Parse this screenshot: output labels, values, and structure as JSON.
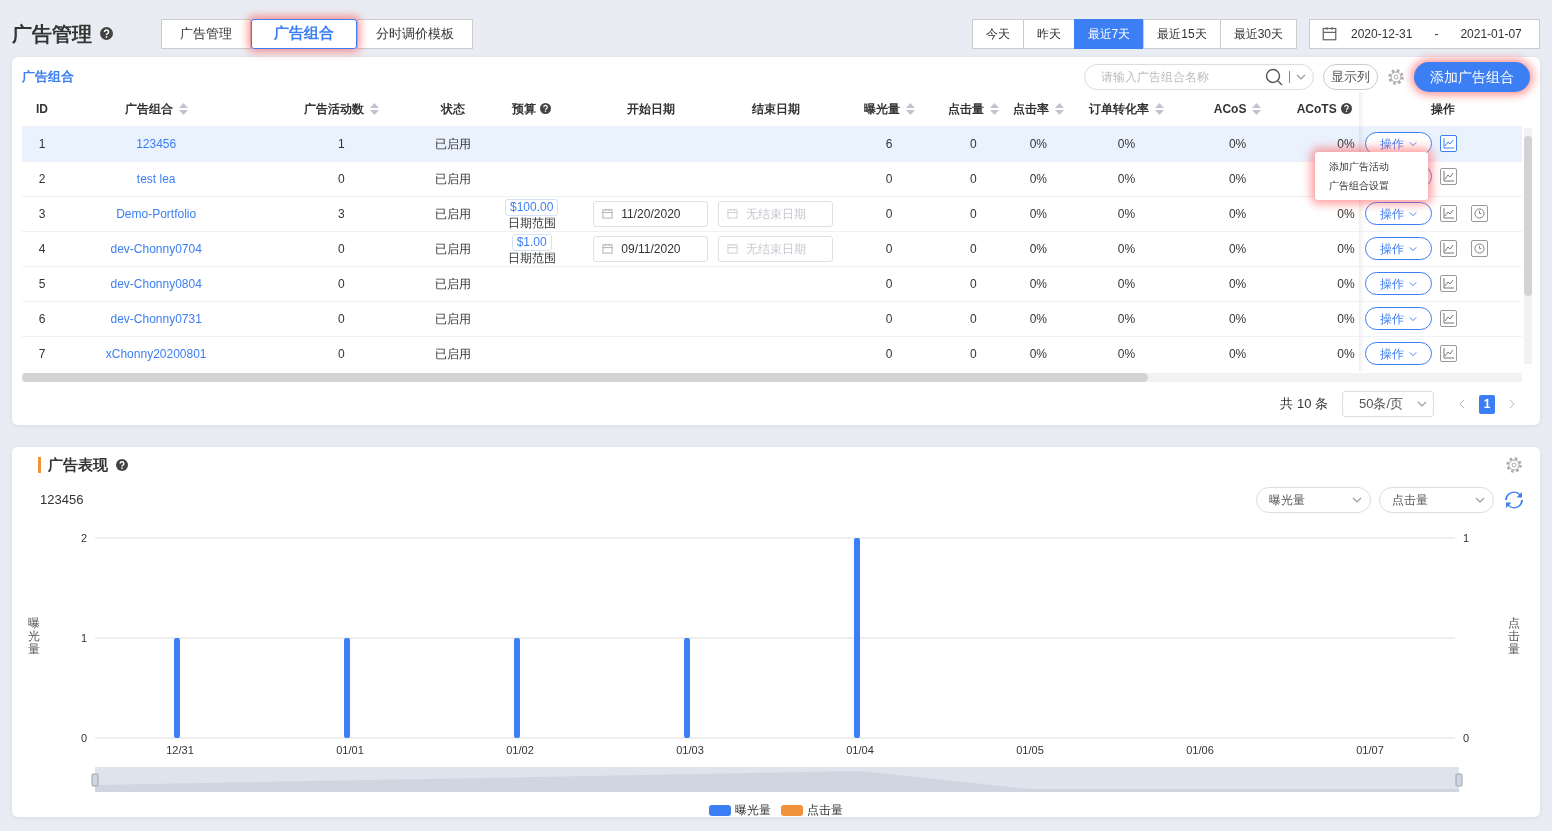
{
  "header": {
    "title": "广告管理",
    "tabs": [
      {
        "label": "广告管理",
        "selected": false
      },
      {
        "label": "广告组合",
        "selected": true
      },
      {
        "label": "分时调价模板",
        "selected": false
      }
    ],
    "ranges": [
      {
        "label": "今天",
        "selected": false
      },
      {
        "label": "昨天",
        "selected": false
      },
      {
        "label": "最近7天",
        "selected": true
      },
      {
        "label": "最近15天",
        "selected": false
      },
      {
        "label": "最近30天",
        "selected": false
      }
    ],
    "date_range": {
      "start": "2020-12-31",
      "separator": "-",
      "end": "2021-01-07"
    }
  },
  "portfolios": {
    "title": "广告组合",
    "search": {
      "placeholder": "请输入广告组合名称"
    },
    "columns_button": "显示列",
    "add_button": "添加广告组合",
    "columns": [
      {
        "label": "ID",
        "sortable": false,
        "help": false
      },
      {
        "label": "广告组合",
        "sortable": true,
        "help": false
      },
      {
        "label": "广告活动数",
        "sortable": true,
        "help": false
      },
      {
        "label": "状态",
        "sortable": false,
        "help": false
      },
      {
        "label": "预算",
        "sortable": false,
        "help": true
      },
      {
        "label": "开始日期",
        "sortable": false,
        "help": false
      },
      {
        "label": "结束日期",
        "sortable": false,
        "help": false
      },
      {
        "label": "曝光量",
        "sortable": true,
        "help": false
      },
      {
        "label": "点击量",
        "sortable": true,
        "help": false
      },
      {
        "label": "点击率",
        "sortable": true,
        "help": false
      },
      {
        "label": "订单转化率",
        "sortable": true,
        "help": false
      },
      {
        "label": "ACoS",
        "sortable": true,
        "help": false
      },
      {
        "label": "ACoTS",
        "sortable": false,
        "help": true
      },
      {
        "label": "操作",
        "sortable": false,
        "help": false
      }
    ],
    "rows": [
      {
        "id": "1",
        "name": "123456",
        "campaigns": "1",
        "status": "已启用",
        "impressions": "6",
        "clicks": "0",
        "ctr": "0%",
        "cvr": "0%",
        "acos": "0%",
        "acots": "0%",
        "action": "操作",
        "schedule": false,
        "selected": true
      },
      {
        "id": "2",
        "name": "test lea",
        "campaigns": "0",
        "status": "已启用",
        "impressions": "0",
        "clicks": "0",
        "ctr": "0%",
        "cvr": "0%",
        "acos": "0%",
        "schedule": false,
        "selected": false
      },
      {
        "id": "3",
        "name": "Demo-Portfolio",
        "campaigns": "3",
        "status": "已启用",
        "budget": "$100.00",
        "budget_note": "日期范围",
        "start_date": "11/20/2020",
        "end_placeholder": "无结束日期",
        "impressions": "0",
        "clicks": "0",
        "ctr": "0%",
        "cvr": "0%",
        "acos": "0%",
        "acots": "0%",
        "action": "操作",
        "schedule": true,
        "selected": false
      },
      {
        "id": "4",
        "name": "dev-Chonny0704",
        "campaigns": "0",
        "status": "已启用",
        "budget": "$1.00",
        "budget_note": "日期范围",
        "start_date": "09/11/2020",
        "end_placeholder": "无结束日期",
        "impressions": "0",
        "clicks": "0",
        "ctr": "0%",
        "cvr": "0%",
        "acos": "0%",
        "acots": "0%",
        "action": "操作",
        "schedule": true,
        "selected": false
      },
      {
        "id": "5",
        "name": "dev-Chonny0804",
        "campaigns": "0",
        "status": "已启用",
        "impressions": "0",
        "clicks": "0",
        "ctr": "0%",
        "cvr": "0%",
        "acos": "0%",
        "acots": "0%",
        "action": "操作",
        "schedule": false,
        "selected": false
      },
      {
        "id": "6",
        "name": "dev-Chonny0731",
        "campaigns": "0",
        "status": "已启用",
        "impressions": "0",
        "clicks": "0",
        "ctr": "0%",
        "cvr": "0%",
        "acos": "0%",
        "acots": "0%",
        "action": "操作",
        "schedule": false,
        "selected": false
      },
      {
        "id": "7",
        "name": "xChonny20200801",
        "campaigns": "0",
        "status": "已启用",
        "impressions": "0",
        "clicks": "0",
        "ctr": "0%",
        "cvr": "0%",
        "acos": "0%",
        "acots": "0%",
        "action": "操作",
        "schedule": false,
        "selected": false
      }
    ],
    "menu": {
      "items": [
        "添加广告活动",
        "广告组合设置"
      ]
    },
    "pagination": {
      "total": "共 10 条",
      "page_size": "50条/页",
      "pages": [
        {
          "label": "1",
          "selected": true
        }
      ]
    }
  },
  "performance": {
    "title": "广告表现",
    "portfolio": "123456",
    "metric_selects": [
      "曝光量",
      "点击量"
    ],
    "chart_data": {
      "type": "bar",
      "ylabel": "曝光量",
      "y2label": "点击量",
      "categories": [
        "12/31",
        "01/01",
        "01/02",
        "01/03",
        "01/04",
        "01/05",
        "01/06",
        "01/07"
      ],
      "yticks": [
        0,
        1,
        2
      ],
      "ylim": [
        0,
        2
      ],
      "y2ticks": [
        0,
        1
      ],
      "y2lim": [
        0,
        1
      ],
      "series": [
        {
          "name": "曝光量",
          "color": "#3c7ef3",
          "values": [
            1,
            1,
            1,
            1,
            2,
            0,
            0,
            0
          ]
        },
        {
          "name": "点击量",
          "color": "#f0923a",
          "values": [
            0,
            0,
            0,
            0,
            0,
            0,
            0,
            0
          ]
        }
      ]
    }
  }
}
